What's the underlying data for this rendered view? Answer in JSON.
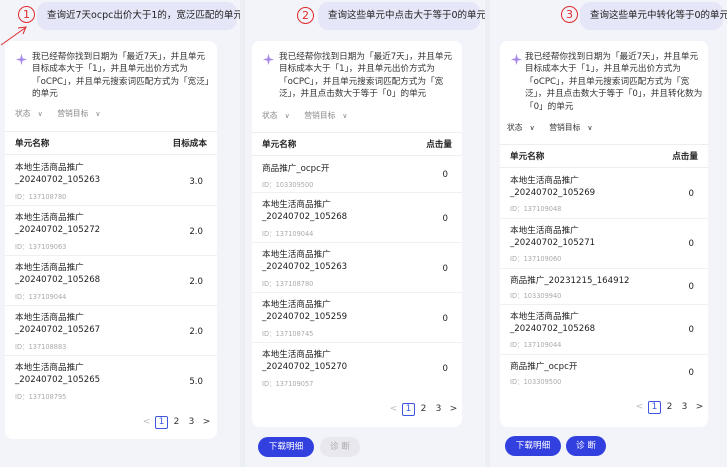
{
  "panels": [
    {
      "step": "1",
      "query": "查询近7天ocpc出价大于1的，宽泛匹配的单元",
      "answer": "我已经帮你找到日期为「最近7天」，并且单元目标成本大于「1」，并且单元出价方式为「oCPC」，并且单元搜索词匹配方式为「宽泛」的单元",
      "filters": [
        "状态",
        "营销目标"
      ],
      "col_name": "单元名称",
      "col_value": "目标成本",
      "rows": [
        {
          "name": "本地生活商品推广_20240702_105263",
          "id": "ID：137108780",
          "value": "3.0"
        },
        {
          "name": "本地生活商品推广_20240702_105272",
          "id": "ID：137109063",
          "value": "2.0"
        },
        {
          "name": "本地生活商品推广_20240702_105268",
          "id": "ID：137109044",
          "value": "2.0"
        },
        {
          "name": "本地生活商品推广_20240702_105267",
          "id": "ID：137108883",
          "value": "2.0"
        },
        {
          "name": "本地生活商品推广_20240702_105265",
          "id": "ID：137108795",
          "value": "5.0"
        }
      ],
      "pager": [
        "<",
        "1",
        "2",
        "3",
        ">"
      ]
    },
    {
      "step": "2",
      "query": "查询这些单元中点击大于等于0的单元",
      "answer": "我已经帮你找到日期为「最近7天」，并且单元目标成本大于「1」，并且单元出价方式为「oCPC」，并且单元搜索词匹配方式为「宽泛」，并且点击数大于等于「0」的单元",
      "filters": [
        "状态",
        "营销目标"
      ],
      "col_name": "单元名称",
      "col_value": "点击量",
      "rows": [
        {
          "name": "商品推广_ocpc开",
          "id": "ID：103309500",
          "value": "0"
        },
        {
          "name": "本地生活商品推广_20240702_105268",
          "id": "ID：137109044",
          "value": "0"
        },
        {
          "name": "本地生活商品推广_20240702_105263",
          "id": "ID：137108780",
          "value": "0"
        },
        {
          "name": "本地生活商品推广_20240702_105259",
          "id": "ID：137108745",
          "value": "0"
        },
        {
          "name": "本地生活商品推广_20240702_105270",
          "id": "ID：137109057",
          "value": "0"
        }
      ],
      "pager": [
        "<",
        "1",
        "2",
        "3",
        ">"
      ],
      "btn_download": "下载明细",
      "btn_diagnose": "诊 断"
    },
    {
      "step": "3",
      "query": "查询这些单元中转化等于0的单元",
      "answer": "我已经帮你找到日期为「最近7天」，并且单元目标成本大于「1」，并且单元出价方式为「oCPC」，并且单元搜索词匹配方式为「宽泛」，并且点击数大于等于「0」，并且转化数为「0」的单元",
      "filters": [
        "状态",
        "营销目标"
      ],
      "col_name": "单元名称",
      "col_value": "点击量",
      "rows": [
        {
          "name": "本地生活商品推广_20240702_105269",
          "id": "ID：137109048",
          "value": "0"
        },
        {
          "name": "本地生活商品推广_20240702_105271",
          "id": "ID：137109060",
          "value": "0"
        },
        {
          "name": "商品推广_20231215_164912",
          "id": "ID：103309940",
          "value": "0"
        },
        {
          "name": "本地生活商品推广_20240702_105268",
          "id": "ID：137109044",
          "value": "0"
        },
        {
          "name": "商品推广_ocpc开",
          "id": "ID：103309500",
          "value": "0"
        }
      ],
      "pager": [
        "<",
        "1",
        "2",
        "3",
        ">"
      ],
      "btn_download": "下载明细",
      "btn_diagnose": "诊 断"
    }
  ],
  "colors": {
    "accent": "#3340e0",
    "annotation": "#e02a2a",
    "bubble": "#e5e6f8"
  },
  "icons": {
    "assistant": "sparkle-icon",
    "dropdown": "chevron-down-icon"
  }
}
